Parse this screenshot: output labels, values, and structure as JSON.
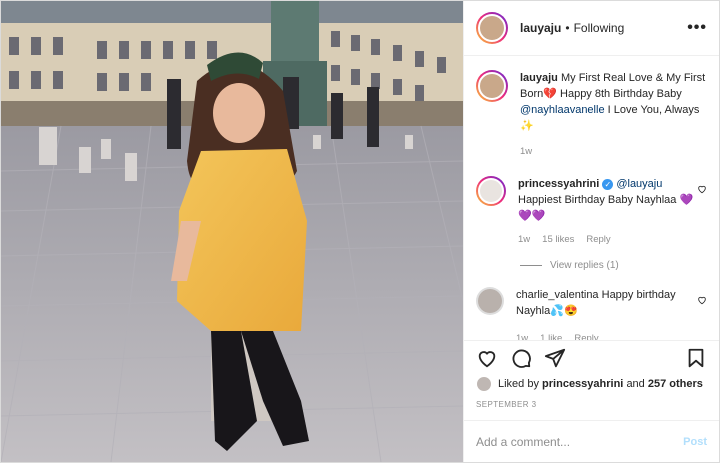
{
  "header": {
    "username": "lauyaju",
    "separator": "•",
    "follow_status": "Following",
    "more_icon": "more-options-icon"
  },
  "caption": {
    "username": "lauyaju",
    "text": "My First Real Love & My First Born",
    "emoji": "💔",
    "text2": " Happy 8th Birthday Baby ",
    "mention": "@nayhlaavanelle",
    "text3": " I Love You, Always ",
    "sparkle": "✨",
    "time": "1w"
  },
  "comments": [
    {
      "username": "princessyahrini",
      "verified": true,
      "mention": "@lauyaju",
      "text": "Happiest Birthday Baby Nayhlaa",
      "hearts": "💜💜💜",
      "time": "1w",
      "likes": "15 likes",
      "reply_label": "Reply",
      "view_replies": "View replies (1)"
    },
    {
      "username": "charlie_valentina",
      "text": "Happy birthday Nayhla",
      "emoji": "💦😍",
      "time": "1w",
      "likes": "1 like",
      "reply_label": "Reply"
    }
  ],
  "likes": {
    "prefix": "Liked by",
    "liker": "princessyahrini",
    "connector": "and",
    "others": "257 others"
  },
  "date": "SEPTEMBER 3",
  "add_comment": {
    "placeholder": "Add a comment...",
    "post_label": "Post"
  },
  "colors": {
    "accent": "#3897f0",
    "post_disabled": "#b2dffc",
    "muted": "#8e8e8e"
  }
}
